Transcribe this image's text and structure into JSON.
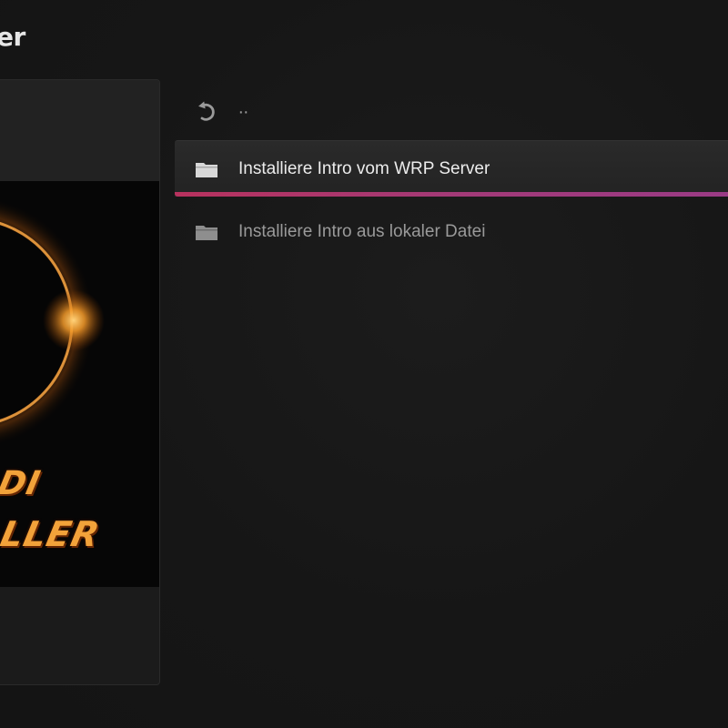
{
  "header": {
    "title": "er"
  },
  "poster": {
    "line1": "ODI",
    "line2": "TALLER"
  },
  "list": {
    "items": [
      {
        "label": "..",
        "icon": "back-arrow-icon"
      },
      {
        "label": "Installiere Intro vom WRP Server",
        "icon": "folder-icon",
        "selected": true
      },
      {
        "label": "Installiere Intro aus lokaler Datei",
        "icon": "folder-icon"
      }
    ]
  },
  "colors": {
    "background": "#161616",
    "accent_start": "#b8325e",
    "accent_end": "#9a3b86",
    "poster_text": "#f2a23a"
  }
}
